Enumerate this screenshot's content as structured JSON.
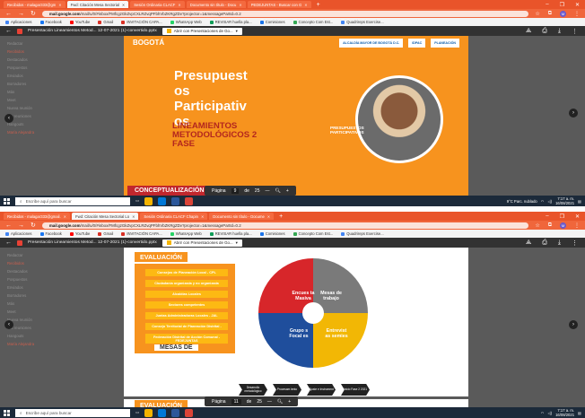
{
  "top": {
    "tabs": [
      {
        "label": "Recibidos - malagar333@gm",
        "active": false
      },
      {
        "label": "Fwd: Citación Mesa Sectorial",
        "active": true
      },
      {
        "label": "Sesión Ordinaria CLACF",
        "active": false
      },
      {
        "label": "Documento sin título - Docu",
        "active": false
      },
      {
        "label": "PEDEJUNTAS - Buscar con G",
        "active": false
      }
    ],
    "url_domain": "mail.google.com",
    "url_rest": "/mail/u/0/#inbox/FMfcgzGkZvpCXLRZvqPFbhVbZKRgZDv?projector=1&messagePartId=0.2",
    "viewer_filename": "Presentación Lineamientos Metod... 12-07-2021 (1)-convertido.pptx",
    "open_with": "Abrir con Presentaciones de Go...",
    "slide": {
      "title_lines": [
        "Presupuest",
        "os",
        "Participativ",
        "os"
      ],
      "subtitle_lines": [
        "LINEAMIENTOS",
        "METODOLÓGICOS 2",
        "FASE"
      ],
      "tag_lines": [
        "PRESUPUESTOS",
        "PARTICIPATIVOS"
      ],
      "footer": "CONCEPTUALIZACIÓN"
    },
    "pager": {
      "label": "Página",
      "current": "9",
      "sep": "de",
      "total": "25"
    },
    "clock": {
      "time": "7:17 a. m.",
      "date": "16/08/2021"
    },
    "weather": "9°C  Parc. nublado"
  },
  "bottom": {
    "tabs": [
      {
        "label": "Recibidos - malagar333@gmail.",
        "active": false
      },
      {
        "label": "Fwd: Citación Mesa Sectorial Lo",
        "active": true
      },
      {
        "label": "Sesión Ordinaria CLACF Chapin",
        "active": false
      },
      {
        "label": "Documento sin título - Docume",
        "active": false
      }
    ],
    "url_domain": "mail.google.com",
    "url_rest": "/mail/u/0/#inbox/FMfcgzGkZvpCXLRZvqPFbhVbZKRgZDv?projector=1&messagePartId=0.2",
    "viewer_filename": "Presentación Lineamientos Metod... 12-07-2021 (1)-convertido.pptx",
    "open_with": "Abrir con Presentaciones de Go...",
    "slide": {
      "eval_title": "EVALUACIÓN",
      "eval_items": [
        "Consejos de Planeación Local - CPL",
        "Ciudadanía organizada y no organizada",
        "Alcaldías Locales",
        "Sectores competentes",
        "Juntas Administradoras Locales - JAL",
        "Consejo Territorial de Planeación Distrital -",
        "Federación Distrital de Acción Comunal - FEDEJUNTAS"
      ],
      "mesas_label": "MESAS DE",
      "wheel_labels": [
        "Encues ta Masiva",
        "Mesas de trabajo",
        "Grupo s Focal es",
        "Entrevist as semies"
      ],
      "steps": [
        "Desarrollo metodológico",
        "Procesam iento",
        "Ajuste e Instrument",
        "Inicio Fase 2 2021"
      ],
      "peek_title": "EVALUACIÓN"
    },
    "pager": {
      "label": "Página",
      "current": "11",
      "sep": "de",
      "total": "25"
    },
    "clock": {
      "time": "7:17 a. m.",
      "date": "16/08/2021"
    }
  },
  "bookmarks": [
    "Aplicaciones",
    "Facebook",
    "YouTube",
    "Gmail",
    "INVITACIÓN CAPA...",
    "WhatsApp Web",
    "REVISAR huella pla...",
    "Comisiones",
    "Concepto Com Est...",
    "Quadrireps Exercise..."
  ],
  "bookmark_list": "Lista de lectura",
  "ghost_items": [
    "Redactar",
    "Recibidos",
    "Destacados",
    "Pospuestos",
    "Enviados",
    "Borradores",
    "Más",
    "Meet",
    "Nueva reunión",
    "Mis reuniones",
    "Hangouts"
  ],
  "ghost_contact": "María Alejandra",
  "search_placeholder": "Escribe aquí para buscar",
  "brand": {
    "left": "BOGOTÁ",
    "logo1": "ALCALDÍA MAYOR DE BOGOTÁ D.C.",
    "logo2": "IDPAC",
    "logo3": "PLANEACIÓN"
  },
  "colors": {
    "orange": "#f7931e",
    "red": "#c1272d",
    "chrome_orange": "#e9542a"
  }
}
